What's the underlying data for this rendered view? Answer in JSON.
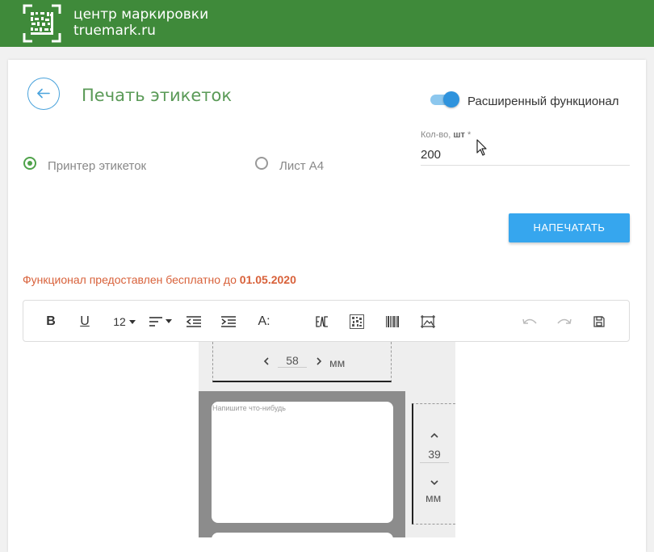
{
  "header": {
    "brand_line1": "центр маркировки",
    "brand_line2": "truemark.ru",
    "accent_color": "#3f8a3a"
  },
  "page": {
    "title": "Печать этикеток",
    "back_icon": "arrow-left-icon"
  },
  "extended_mode": {
    "label": "Расширенный функционал",
    "enabled": true
  },
  "print_target": {
    "options": [
      "Принтер этикеток",
      "Лист А4"
    ],
    "selected": "Принтер этикеток"
  },
  "quantity": {
    "label": "Кол-во,",
    "unit": "шт",
    "required_mark": "*",
    "value": "200"
  },
  "print_button": {
    "label": "НАПЕЧАТАТЬ"
  },
  "promo": {
    "text": "Функционал предоставлен бесплатно до ",
    "date": "01.05.2020"
  },
  "toolbar": {
    "bold": "B",
    "underline": "U",
    "font_size": "12",
    "align_icon": "align-left-icon",
    "outdent_icon": "outdent-icon",
    "indent_icon": "indent-icon",
    "font_format": "A:",
    "eac_icon": "eac-mark-icon",
    "datamatrix_icon": "datamatrix-icon",
    "barcode_icon": "barcode-icon",
    "image_icon": "image-frame-icon",
    "undo_icon": "undo-icon",
    "redo_icon": "redo-icon",
    "save_icon": "save-icon"
  },
  "label_editor": {
    "width_value": "58",
    "width_unit": "мм",
    "height_value": "39",
    "height_unit": "мм",
    "placeholder": "Напишите что-нибудь"
  }
}
